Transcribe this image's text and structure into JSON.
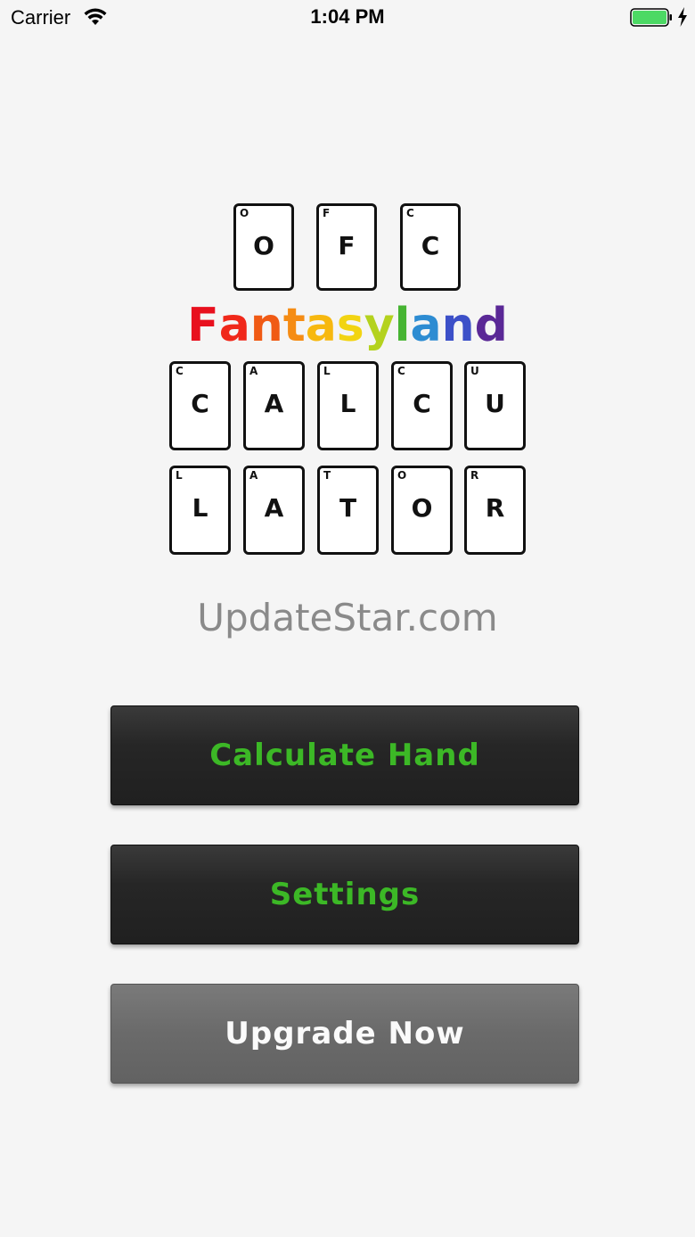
{
  "status_bar": {
    "carrier": "Carrier",
    "time": "1:04 PM",
    "battery_color": "#4cd964"
  },
  "logo": {
    "top_row": [
      {
        "corner": "O",
        "center": "O"
      },
      {
        "corner": "F",
        "center": "F"
      },
      {
        "corner": "C",
        "center": "C"
      }
    ],
    "middle_row": [
      {
        "corner": "C",
        "center": "C"
      },
      {
        "corner": "A",
        "center": "A"
      },
      {
        "corner": "L",
        "center": "L"
      },
      {
        "corner": "C",
        "center": "C"
      },
      {
        "corner": "U",
        "center": "U"
      }
    ],
    "bottom_row": [
      {
        "corner": "L",
        "center": "L"
      },
      {
        "corner": "A",
        "center": "A"
      },
      {
        "corner": "T",
        "center": "T"
      },
      {
        "corner": "O",
        "center": "O"
      },
      {
        "corner": "R",
        "center": "R"
      }
    ],
    "fantasyland_letters": [
      "F",
      "a",
      "n",
      "t",
      "a",
      "s",
      "y",
      "l",
      "a",
      "n",
      "d"
    ],
    "fantasyland_colors": [
      "#e8101e",
      "#f0281a",
      "#f05a14",
      "#f58c14",
      "#f7b80f",
      "#f2d412",
      "#b4d21e",
      "#46b432",
      "#2d8cd2",
      "#3c50c8",
      "#5a2896"
    ]
  },
  "watermark": "UpdateStar.com",
  "buttons": {
    "calculate_hand": "Calculate Hand",
    "settings": "Settings",
    "upgrade_now": "Upgrade Now"
  },
  "colors": {
    "accent_green": "#3cb826",
    "dark_button": "#262626",
    "gray_button": "#6a6a6a"
  }
}
